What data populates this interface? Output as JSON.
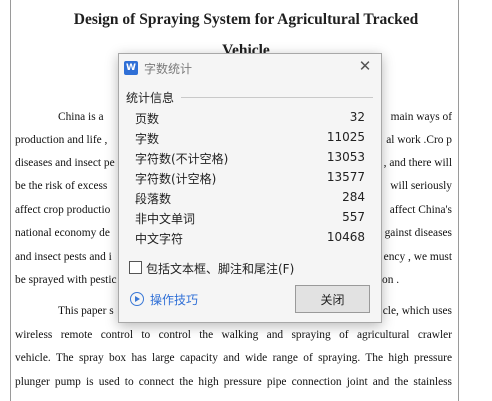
{
  "document": {
    "title_line1": "Design of Spraying System for Agricultural Tracked",
    "title_line2": "Vehicle",
    "lines_para1": [
      "China is a",
      "main ways of",
      "production and life ,",
      "al work .Cro p",
      "diseases and insect pe",
      ", and there will",
      "be the risk of excess",
      "will seriously",
      "affect crop productio",
      "affect China's",
      "national economy de",
      "gainst diseases",
      "and insect pests and i",
      "ency , we must",
      "be sprayed with pestic",
      "on ."
    ],
    "lines_para2": [
      "This paper s",
      "cle, which uses",
      "wireless remote control to control the walking and spraying of agricultural crawler",
      "vehicle. The spray box has large capacity and wide range of spraying. The high pressure",
      "plunger pump is used to connect the high pressure pipe connection joint and the stainless"
    ]
  },
  "dialog": {
    "title": "字数统计",
    "app_icon_letter": "W",
    "close_glyph": "✕",
    "group_label": "统计信息",
    "stats": [
      {
        "label": "页数",
        "value": "32"
      },
      {
        "label": "字数",
        "value": "11025"
      },
      {
        "label": "字符数(不计空格)",
        "value": "13053"
      },
      {
        "label": "字符数(计空格)",
        "value": "13577"
      },
      {
        "label": "段落数",
        "value": "284"
      },
      {
        "label": "非中文单词",
        "value": "557"
      },
      {
        "label": "中文字符",
        "value": "10468"
      }
    ],
    "checkbox_label": "包括文本框、脚注和尾注(F)",
    "tips_label": "操作技巧",
    "close_button": "关闭"
  }
}
